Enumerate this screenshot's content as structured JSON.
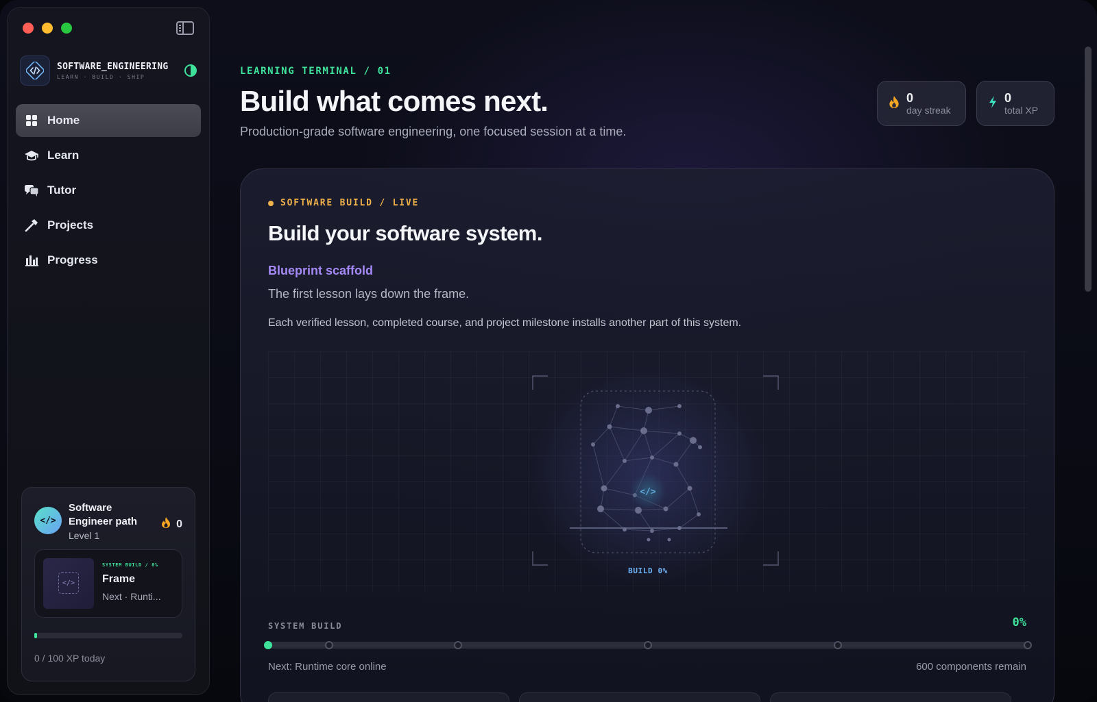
{
  "sidebar": {
    "brand": {
      "title": "SOFTWARE_ENGINEERING",
      "subtitle": "LEARN · BUILD · SHIP"
    },
    "nav": [
      {
        "label": "Home",
        "icon": "grid-icon",
        "active": true
      },
      {
        "label": "Learn",
        "icon": "graduation-cap-icon"
      },
      {
        "label": "Tutor",
        "icon": "chat-bubbles-icon"
      },
      {
        "label": "Projects",
        "icon": "hammer-icon"
      },
      {
        "label": "Progress",
        "icon": "bar-chart-icon"
      }
    ],
    "path_card": {
      "title": "Software Engineer path",
      "level": "Level 1",
      "streak": "0",
      "avatar": "</>",
      "mini": {
        "tag": "SYSTEM BUILD / 0%",
        "title": "Frame",
        "next": "Next · Runti..."
      },
      "xp_text": "0 / 100 XP today",
      "xp_progress": 0.02
    }
  },
  "main": {
    "kicker": "LEARNING TERMINAL / 01",
    "title": "Build what comes next.",
    "subtitle": "Production-grade software engineering, one focused session at a time.",
    "stats": {
      "streak": {
        "value": "0",
        "label": "day streak"
      },
      "xp": {
        "value": "0",
        "label": "total XP"
      }
    },
    "card": {
      "live_label": "SOFTWARE BUILD / LIVE",
      "title": "Build your software system.",
      "stage_name": "Blueprint scaffold",
      "stage_desc": "The first lesson lays down the frame.",
      "note": "Each verified lesson, completed course, and project milestone installs another part of this system.",
      "viz_label": "BUILD 0%",
      "system_label": "SYSTEM BUILD",
      "system_pct": "0%",
      "next": "Next: Runtime core online",
      "remain": "600 components remain",
      "milestones": [
        0,
        0.08,
        0.25,
        0.5,
        0.75,
        1.0
      ]
    }
  },
  "colors": {
    "accent_green": "#3ee29b",
    "accent_amber": "#f0b24a",
    "accent_violet": "#a58af7",
    "accent_blue": "#6fb4f5"
  }
}
